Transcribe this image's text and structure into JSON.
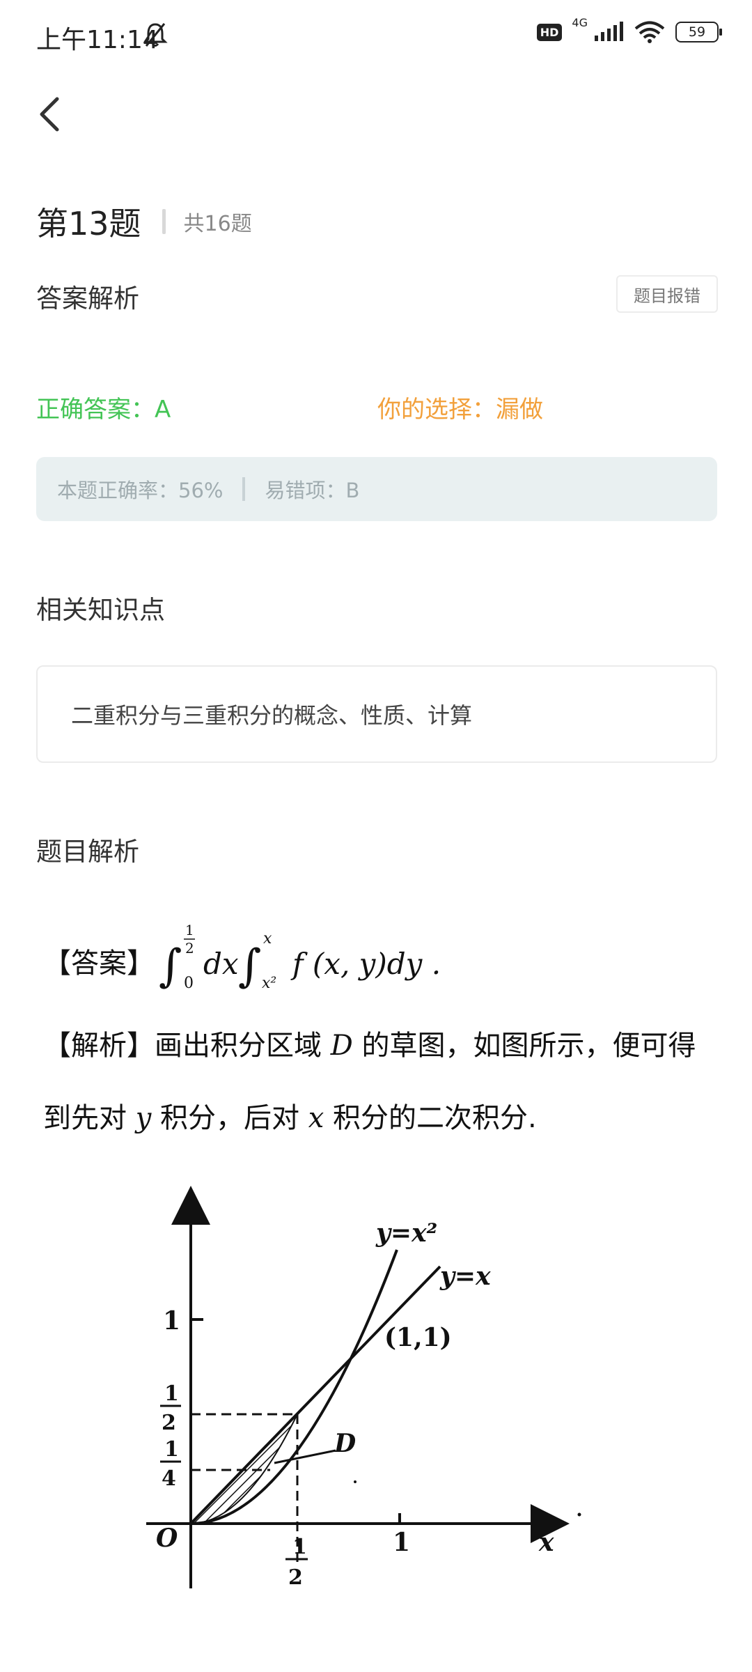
{
  "status_bar": {
    "time": "上午11:14",
    "network": "4G",
    "hd": "HD",
    "battery": "59"
  },
  "question": {
    "number": "第13题",
    "total": "共16题"
  },
  "answer_analysis": {
    "title": "答案解析",
    "report_button": "题目报错",
    "correct_answer": "正确答案：A",
    "your_choice": "你的选择：漏做",
    "accuracy": "本题正确率：56%",
    "common_error": "易错项：B"
  },
  "knowledge": {
    "title": "相关知识点",
    "item": "二重积分与三重积分的概念、性质、计算"
  },
  "solution": {
    "title": "题目解析",
    "answer_tag": "【答案】",
    "formula": {
      "upper1_num": "1",
      "upper1_den": "2",
      "lower1": "0",
      "dx": "dx",
      "upper2": "x",
      "lower2": "x²",
      "integrand": "f (x, y)dy ."
    },
    "explain_line1_a": "【解析】画出积分区域",
    "explain_line1_var": "D",
    "explain_line1_b": "的草图，如图所示，便可得",
    "explain_line2_a": "到先对",
    "explain_line2_var1": "y",
    "explain_line2_b": "积分，后对",
    "explain_line2_var2": "x",
    "explain_line2_c": "积分的二次积分."
  },
  "figure": {
    "curve1_label": "y=x²",
    "curve2_label": "y=x",
    "point_label": "(1,1)",
    "region_label": "D",
    "origin_label": "O",
    "x_axis_label": "x",
    "y_tick_1": "1",
    "y_tick_half_num": "1",
    "y_tick_half_den": "2",
    "y_tick_quarter_num": "1",
    "y_tick_quarter_den": "4",
    "x_tick_half_num": "1",
    "x_tick_half_den": "2",
    "x_tick_1": "1"
  }
}
